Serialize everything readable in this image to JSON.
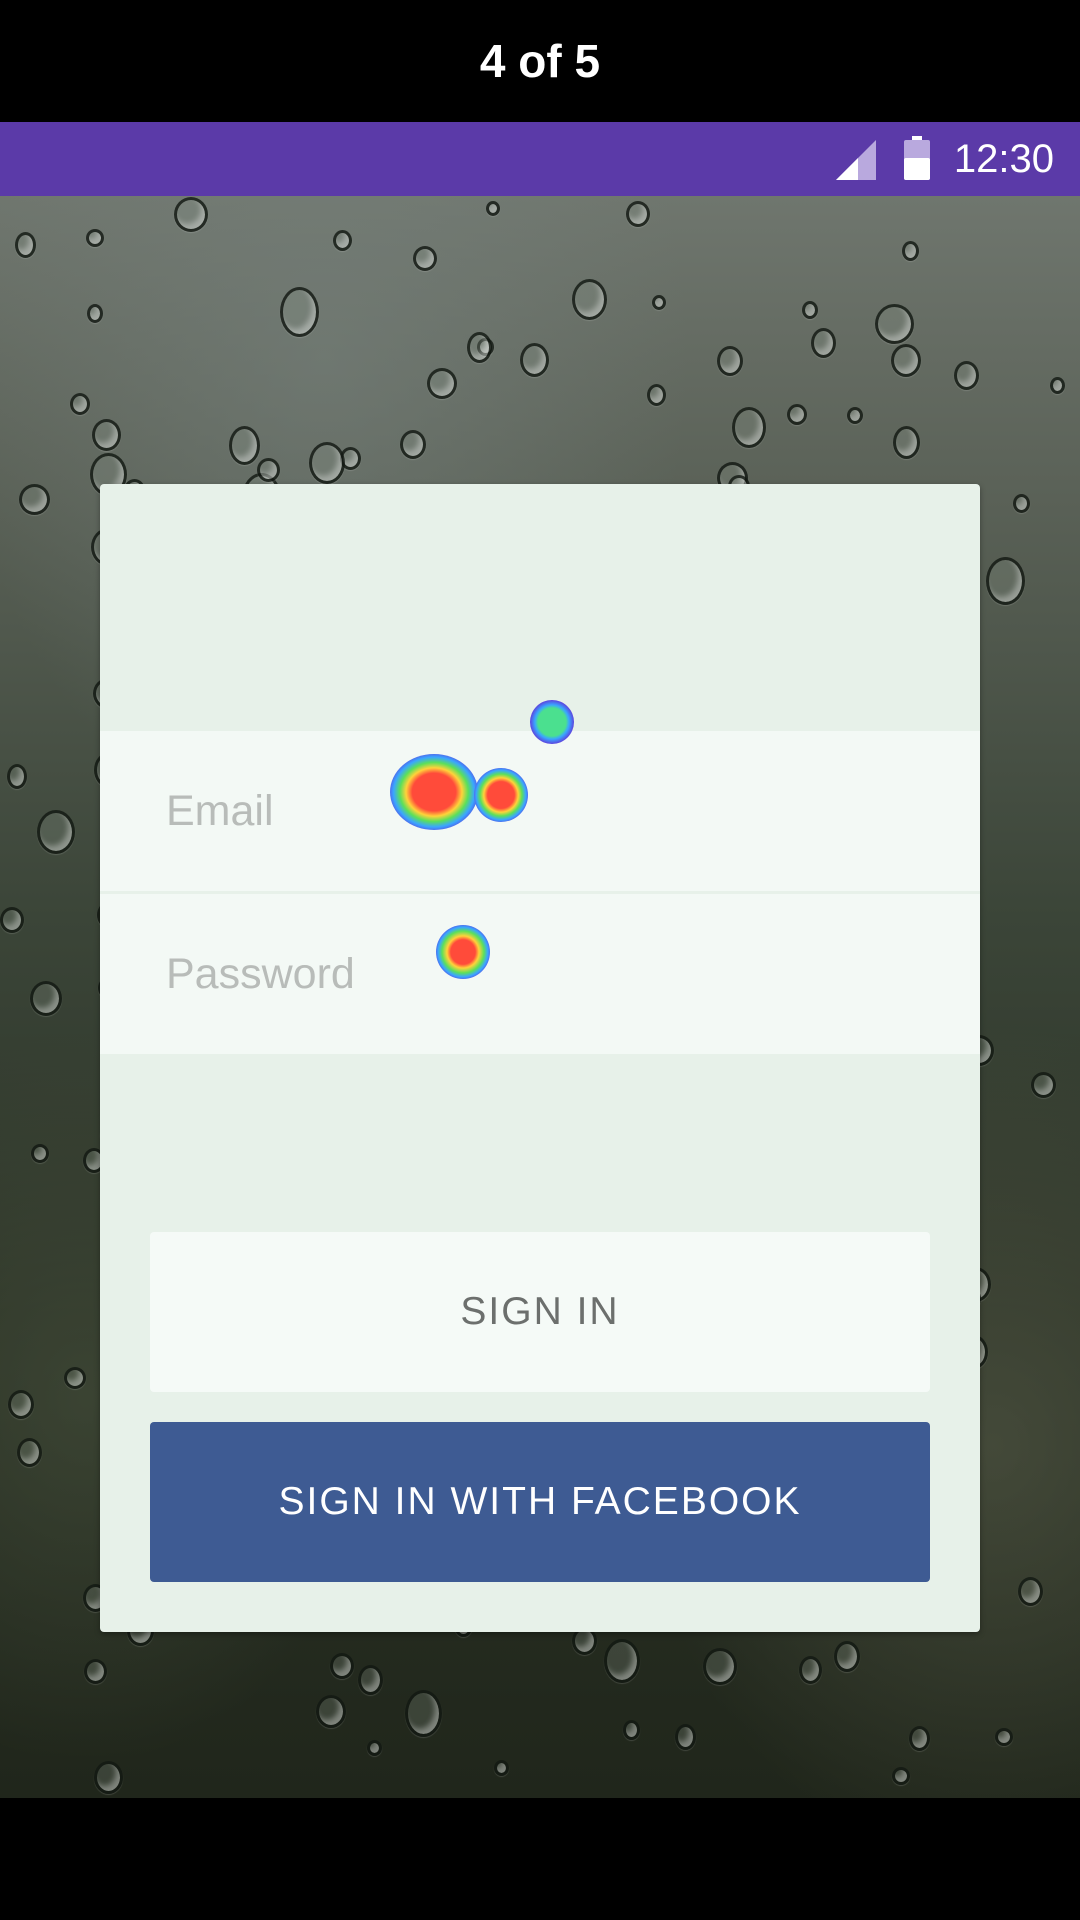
{
  "caption": {
    "text": "4 of 5"
  },
  "status_bar": {
    "time": "12:30",
    "signal_icon": "cell-signal-icon",
    "battery_icon": "battery-icon",
    "color": "#5b3aa8"
  },
  "login": {
    "email_placeholder": "Email",
    "password_placeholder": "Password",
    "sign_in_label": "SIGN IN",
    "facebook_label": "SIGN IN WITH FACEBOOK",
    "facebook_color": "#3e5b93"
  }
}
